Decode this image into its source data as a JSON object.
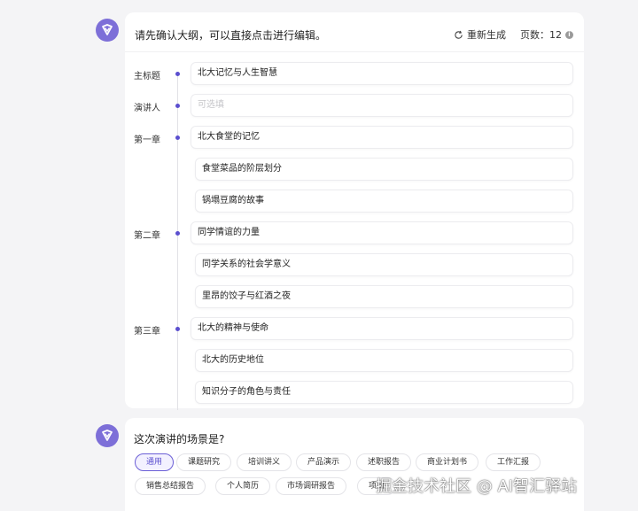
{
  "outline_prompt": "请先确认大纲，可以直接点击进行编辑。",
  "regenerate_label": "重新生成",
  "page_count_label": "页数：12",
  "title_row": {
    "label": "主标题",
    "value": "北大记忆与人生智慧"
  },
  "speaker_row": {
    "label": "演讲人",
    "placeholder": "可选填"
  },
  "chapters": [
    {
      "label": "第一章",
      "title": "北大食堂的记忆",
      "subs": [
        "食堂菜品的阶层划分",
        "锅塌豆腐的故事"
      ]
    },
    {
      "label": "第二章",
      "title": "同学情谊的力量",
      "subs": [
        "同学关系的社会学意义",
        "里昂的饺子与红酒之夜"
      ]
    },
    {
      "label": "第三章",
      "title": "北大的精神与使命",
      "subs": [
        "北大的历史地位",
        "知识分子的角色与责任"
      ]
    }
  ],
  "scene_question": "这次演讲的场景是?",
  "scene_options": [
    "通用",
    "课题研究",
    "培训讲义",
    "产品演示",
    "述职报告",
    "商业计划书",
    "工作汇报",
    "销售总结报告",
    "个人简历",
    "市场调研报告",
    "项目"
  ],
  "selected_scene": "通用",
  "watermark": "掘金技术社区 @ AI智汇驿站",
  "accent_color": "#5b4fcf"
}
